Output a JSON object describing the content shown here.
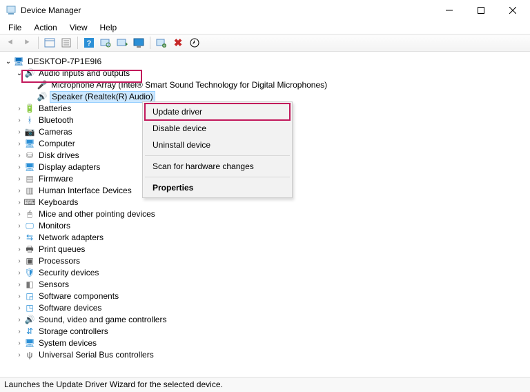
{
  "window": {
    "title": "Device Manager"
  },
  "menu": {
    "file": "File",
    "action": "Action",
    "view": "View",
    "help": "Help"
  },
  "toolbar_icons": {
    "back": "⬅",
    "forward": "➡",
    "show_hidden": "▭",
    "properties": "▦",
    "help": "?",
    "refresh": "🖵",
    "scan": "🗔",
    "update": "🖥",
    "add": "🖳",
    "delete": "✖",
    "legacy": "⊕"
  },
  "tree": {
    "root": {
      "label": "DESKTOP-7P1E9I6"
    },
    "audio": {
      "label": "Audio inputs and outputs",
      "children": [
        {
          "label": "Microphone Array (Intel® Smart Sound Technology for Digital Microphones)"
        },
        {
          "label": "Speaker (Realtek(R) Audio)",
          "selected": true
        }
      ]
    },
    "categories": [
      {
        "key": "batteries",
        "label": "Batteries",
        "icon": "🔋",
        "cls": "ic-batt"
      },
      {
        "key": "bluetooth",
        "label": "Bluetooth",
        "icon": "ᚼ",
        "cls": "ic-bt"
      },
      {
        "key": "cameras",
        "label": "Cameras",
        "icon": "📷",
        "cls": "ic-cam"
      },
      {
        "key": "computer",
        "label": "Computer",
        "icon": "🖥",
        "cls": "ic-disp"
      },
      {
        "key": "disk",
        "label": "Disk drives",
        "icon": "⛁",
        "cls": "ic-disk"
      },
      {
        "key": "display",
        "label": "Display adapters",
        "icon": "🖥",
        "cls": "ic-disp"
      },
      {
        "key": "firmware",
        "label": "Firmware",
        "icon": "▤",
        "cls": "ic-fw"
      },
      {
        "key": "hid",
        "label": "Human Interface Devices",
        "icon": "▥",
        "cls": "ic-hid"
      },
      {
        "key": "keyboards",
        "label": "Keyboards",
        "icon": "⌨",
        "cls": "ic-kb"
      },
      {
        "key": "mice",
        "label": "Mice and other pointing devices",
        "icon": "🖱",
        "cls": "ic-mouse"
      },
      {
        "key": "monitors",
        "label": "Monitors",
        "icon": "🖵",
        "cls": "ic-mon"
      },
      {
        "key": "network",
        "label": "Network adapters",
        "icon": "⇆",
        "cls": "ic-net"
      },
      {
        "key": "print",
        "label": "Print queues",
        "icon": "🖶",
        "cls": "ic-prn"
      },
      {
        "key": "processors",
        "label": "Processors",
        "icon": "▣",
        "cls": "ic-cpu"
      },
      {
        "key": "security",
        "label": "Security devices",
        "icon": "🛡",
        "cls": "ic-sec"
      },
      {
        "key": "sensors",
        "label": "Sensors",
        "icon": "◧",
        "cls": "ic-sen"
      },
      {
        "key": "swcomp",
        "label": "Software components",
        "icon": "◲",
        "cls": "ic-sw"
      },
      {
        "key": "swdev",
        "label": "Software devices",
        "icon": "◳",
        "cls": "ic-sw"
      },
      {
        "key": "sound",
        "label": "Sound, video and game controllers",
        "icon": "🔊",
        "cls": "ic-snd"
      },
      {
        "key": "storage",
        "label": "Storage controllers",
        "icon": "⇵",
        "cls": "ic-stor"
      },
      {
        "key": "system",
        "label": "System devices",
        "icon": "🖥",
        "cls": "ic-sys"
      },
      {
        "key": "usb",
        "label": "Universal Serial Bus controllers",
        "icon": "ψ",
        "cls": "ic-usb"
      }
    ]
  },
  "context_menu": {
    "update": "Update driver",
    "disable": "Disable device",
    "uninstall": "Uninstall device",
    "scan": "Scan for hardware changes",
    "properties": "Properties"
  },
  "statusbar": "Launches the Update Driver Wizard for the selected device."
}
